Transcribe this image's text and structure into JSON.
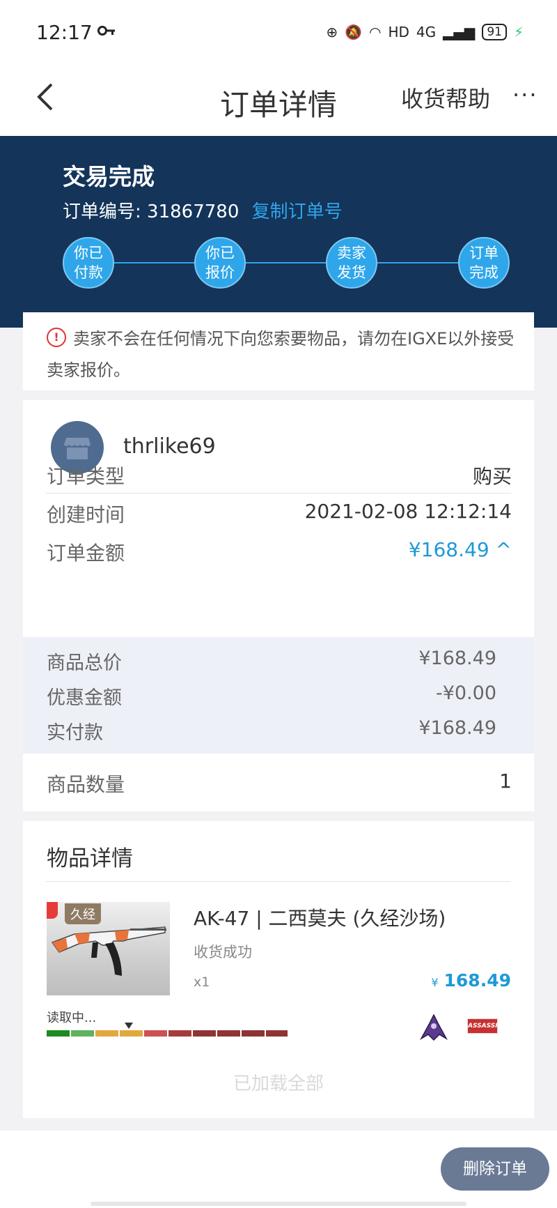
{
  "status_bar": {
    "time": "12:17",
    "network": "HD",
    "signal": "4G",
    "battery": "91"
  },
  "nav": {
    "back_icon": "chevron-left-icon",
    "title": "订单详情",
    "help": "收货帮助",
    "more": "···"
  },
  "order": {
    "status_title": "交易完成",
    "number_label": "订单编号:",
    "number": "31867780",
    "copy_label": "复制订单号",
    "steps": [
      "你已\n付款",
      "你已\n报价",
      "卖家\n发货",
      "订单\n完成"
    ]
  },
  "notice": {
    "icon": "!",
    "text": "卖家不会在任何情况下向您索要物品，请勿在IGXE以外接受卖家报价。"
  },
  "seller": {
    "name": "thrlike69"
  },
  "details": {
    "order_type_label": "订单类型",
    "order_type": "购买",
    "created_label": "创建时间",
    "created": "2021-02-08 12:12:14",
    "amount_label": "订单金额",
    "amount": "¥168.49 ^",
    "goods_total_label": "商品总价",
    "goods_total": "¥168.49",
    "discount_label": "优惠金额",
    "discount": "-¥0.00",
    "paid_label": "实付款",
    "paid": "¥168.49",
    "quantity_label": "商品数量",
    "quantity": "1"
  },
  "items": {
    "title": "物品详情",
    "list": [
      {
        "badge": "久经",
        "name": "AK-47 | 二西莫夫 (久经沙场)",
        "status": "收货成功",
        "qty": "x1",
        "currency": "¥",
        "price": "168.49",
        "wear_label": "读取中...",
        "sticker2_text": "ASSASSIN"
      }
    ],
    "footer": "已加载全部"
  },
  "actions": {
    "delete": "删除订单"
  },
  "colors": {
    "header": "#14345a",
    "accent": "#2fa6ea",
    "price": "#1d9ad6",
    "button": "#6a7a95"
  }
}
